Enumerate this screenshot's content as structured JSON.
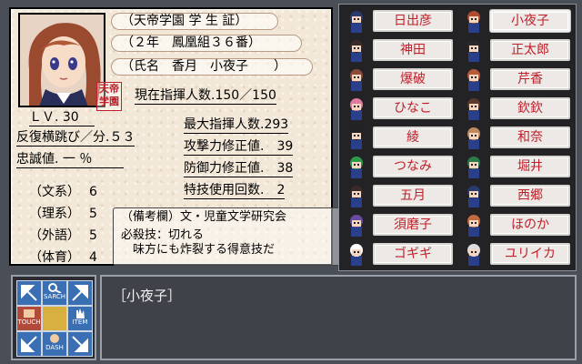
{
  "card": {
    "title": "（天帝学園 学 生 証）",
    "class_line": "（２年　鳳凰組３６番）",
    "name_line": "（氏名　香月　小夜子　　）",
    "stamp_text": "天帝学園",
    "current_command": "現在指揮人数.150／150",
    "level": "ＬＶ. 30",
    "repeat_jump": "反復横跳び／分.５３",
    "loyalty": "忠誠値. 一 ％",
    "max_command": "最大指揮人数.293",
    "attack_mod": "攻撃力修正値.　39",
    "defense_mod": "防御力修正値.　38",
    "special_uses": "特技使用回数.　2",
    "subjects": [
      {
        "label": "（文系）",
        "value": "6"
      },
      {
        "label": "（理系）",
        "value": "5"
      },
      {
        "label": "（外語）",
        "value": "5"
      },
      {
        "label": "（体育）",
        "value": "4"
      }
    ],
    "notes_header": "（備考欄）文・児童文学研究会",
    "notes_line1": "必殺技：切れる",
    "notes_line2": "　味方にも炸裂する得意技だ"
  },
  "roster": {
    "left": [
      "日出彦",
      "神田",
      "爆破",
      "ひなこ",
      "綾",
      "つなみ",
      "五月",
      "須磨子",
      "ゴギギ"
    ],
    "right": [
      "小夜子",
      "正太郎",
      "芹香",
      "欽欽",
      "和奈",
      "堀井",
      "西郷",
      "ほのか",
      "ユリイカ"
    ],
    "selected": "小夜子",
    "portrait_colors_left": [
      "#2a3a6a",
      "#3a2a2a",
      "#8a4a3a",
      "#e07aa0",
      "#222222",
      "#2f9a4a",
      "#3a2a2a",
      "#6a4aa0",
      "#ffffff"
    ],
    "portrait_colors_right": [
      "#b04a30",
      "#2a2a2a",
      "#b85a3a",
      "#5a3a2a",
      "#c08a60",
      "#2a7a4a",
      "#2a3a6a",
      "#c06a40",
      "#dddddd"
    ]
  },
  "commands": {
    "search": "SARCH",
    "touch": "TOUCH",
    "item": "ITEM",
    "dash": "DASH"
  },
  "dialog": {
    "speaker": "［小夜子］"
  }
}
